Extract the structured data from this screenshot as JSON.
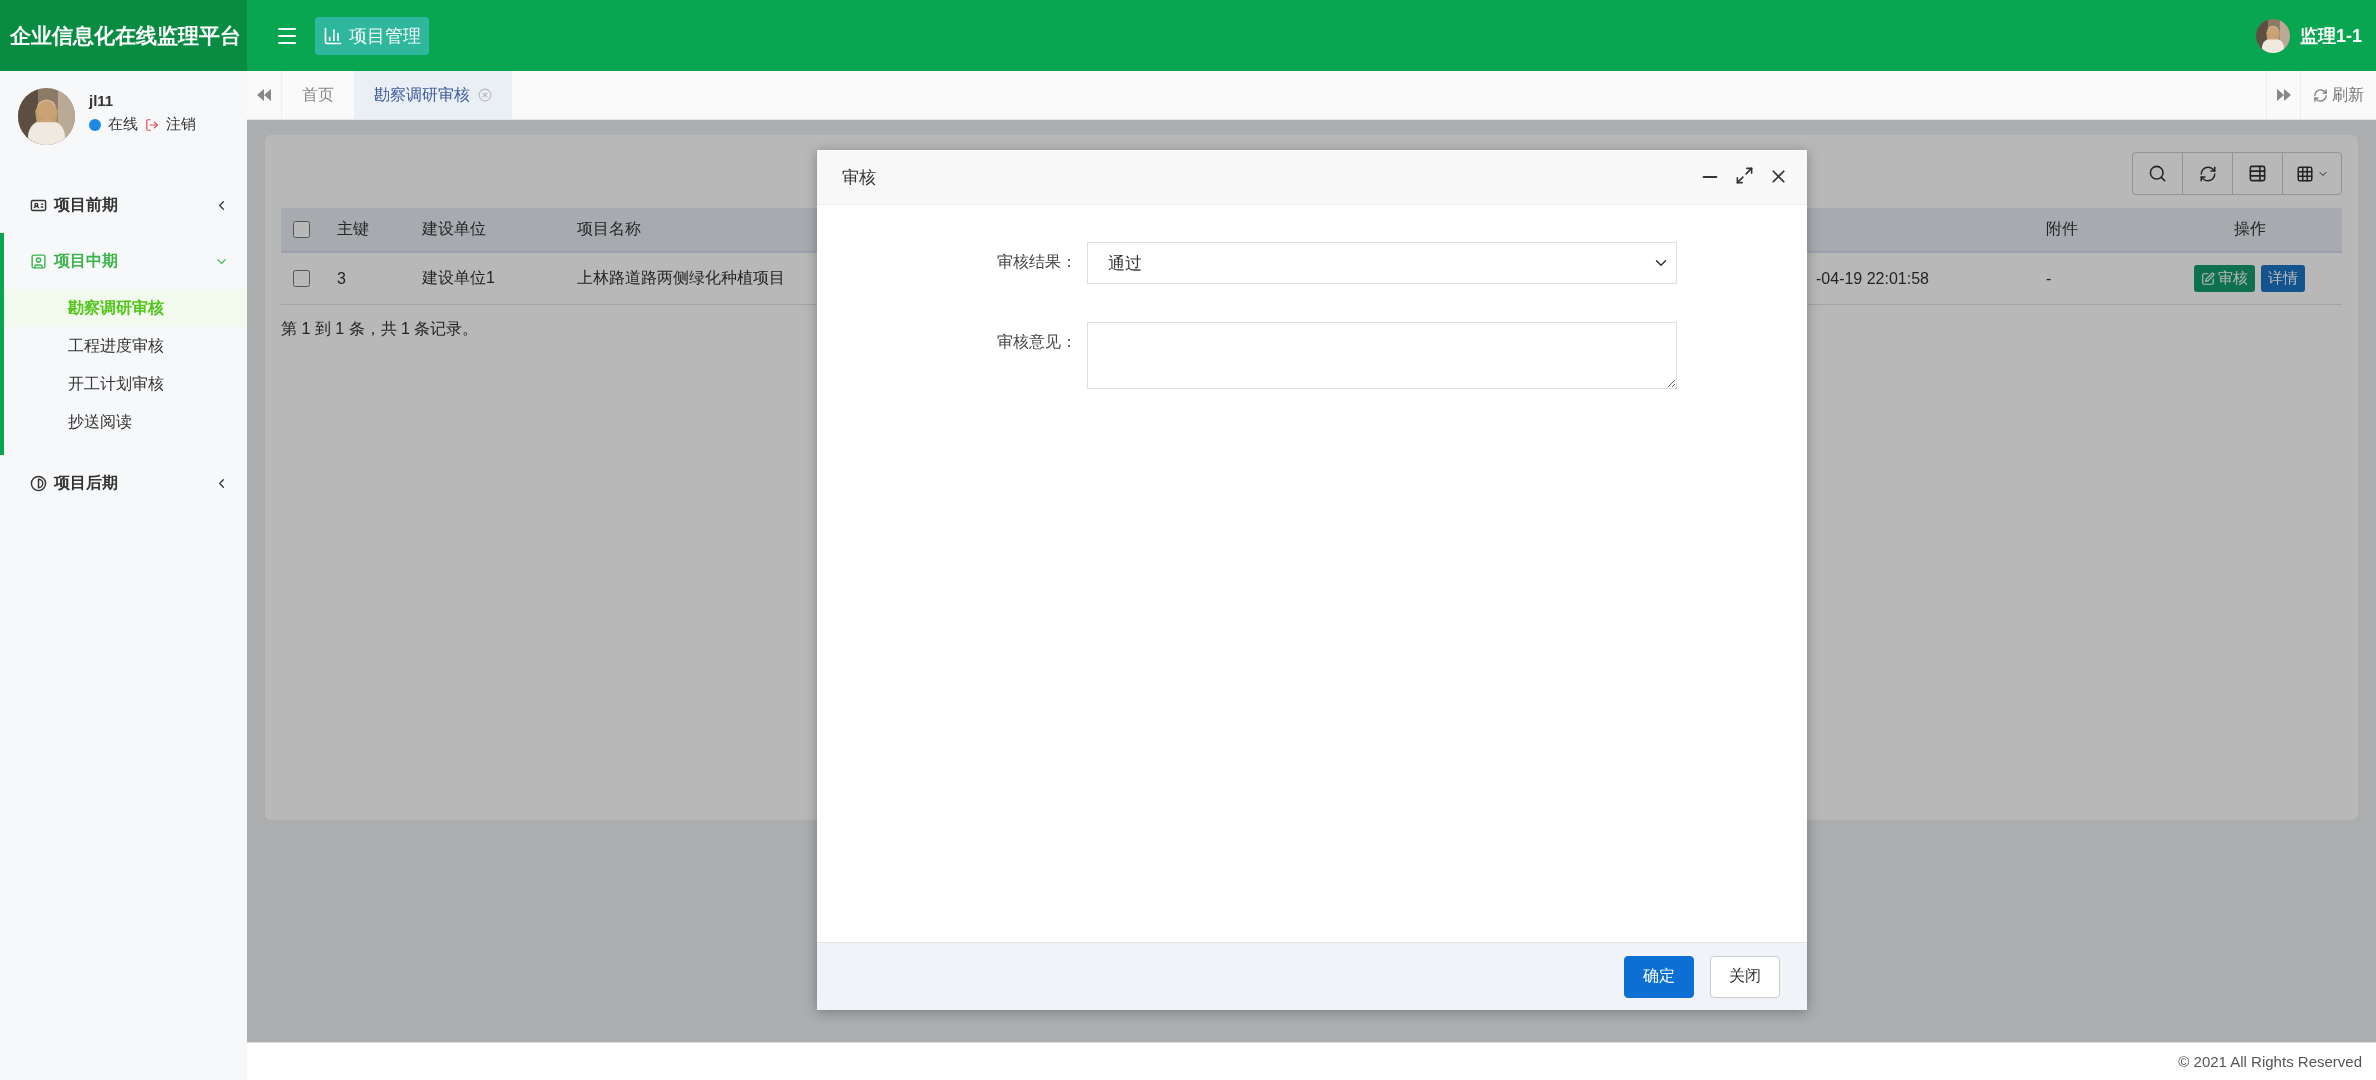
{
  "app_title": "企业信息化在线监理平台",
  "topbar": {
    "menu_label": "项目管理",
    "user": "监理1-1"
  },
  "sidebar": {
    "user": {
      "name": "jl11",
      "status": "在线",
      "logout": "注销"
    },
    "groups": [
      {
        "label": "项目前期",
        "expanded": false
      },
      {
        "label": "项目中期",
        "expanded": true,
        "children": [
          {
            "label": "勘察调研审核",
            "selected": true
          },
          {
            "label": "工程进度审核",
            "selected": false
          },
          {
            "label": "开工计划审核",
            "selected": false
          },
          {
            "label": "抄送阅读",
            "selected": false
          }
        ]
      },
      {
        "label": "项目后期",
        "expanded": false
      }
    ]
  },
  "tabs": [
    {
      "label": "首页",
      "selected": false
    },
    {
      "label": "勘察调研审核",
      "selected": true
    }
  ],
  "refresh_label": "刷新",
  "table": {
    "header_checked": false,
    "columns": [
      "主键",
      "建设单位",
      "项目名称",
      "",
      "附件",
      "操作"
    ],
    "rows": [
      {
        "checked": false,
        "cells": [
          "3",
          "建设单位1",
          "上林路道路两侧绿化种植项目",
          "-04-19 22:01:58",
          "-"
        ],
        "actions": [
          {
            "label": "审核",
            "kind": "edit"
          },
          {
            "label": "详情",
            "kind": "info"
          }
        ]
      }
    ]
  },
  "pagination": "第 1 到 1 条，共 1 条记录。",
  "dialog": {
    "title": "审核",
    "fields": [
      {
        "kind": "select",
        "label": "审核结果：",
        "value": "通过"
      },
      {
        "kind": "textarea",
        "label": "审核意见："
      }
    ],
    "buttons": [
      {
        "label": "确定",
        "kind": "primary"
      },
      {
        "label": "关闭",
        "kind": "default"
      }
    ]
  },
  "footer": "© 2021 All Rights Reserved"
}
